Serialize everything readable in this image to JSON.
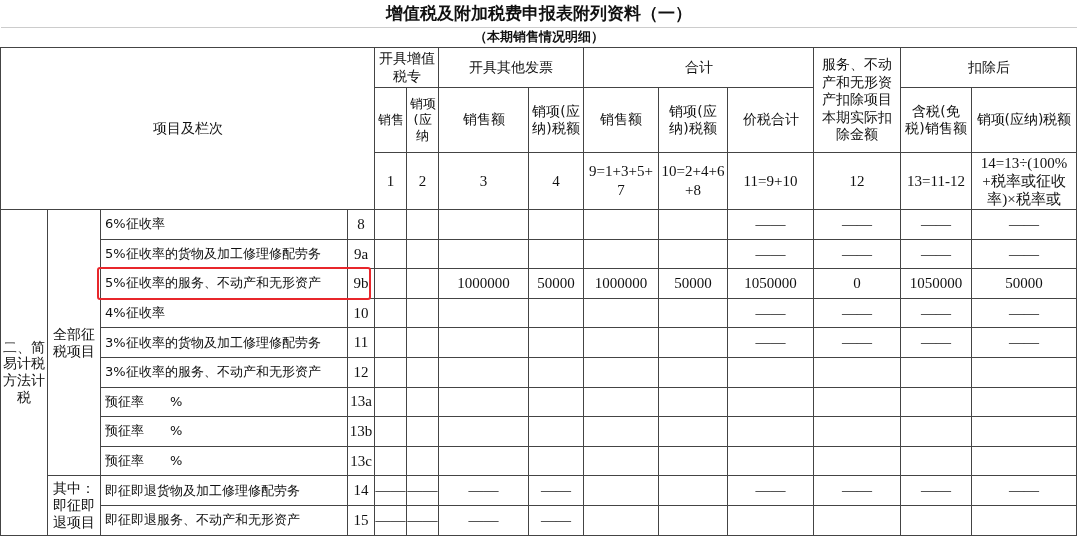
{
  "title": "增值税及附加税费申报表附列资料（一）",
  "subtitle": "（本期销售情况明细）",
  "item_header": "项目及栏次",
  "column_groups": [
    {
      "kind": "group",
      "label": "开具增值税专",
      "columns": [
        {
          "label": "销售",
          "number": "1"
        },
        {
          "label": "销项(应纳",
          "number": "2"
        }
      ]
    },
    {
      "kind": "group",
      "label": "开具其他发票",
      "columns": [
        {
          "label": "销售额",
          "number": "3"
        },
        {
          "label": "销项(应纳)税额",
          "number": "4"
        }
      ]
    },
    {
      "kind": "group",
      "label": "合计",
      "columns": [
        {
          "label": "销售额",
          "number": "9=1+3+5+7"
        },
        {
          "label": "销项(应纳)税额",
          "number": "10=2+4+6+8"
        },
        {
          "label": "价税合计",
          "number": "11=9+10"
        }
      ]
    },
    {
      "kind": "single",
      "label": "服务、不动产和无形资产扣除项目本期实际扣除金额",
      "number": "12"
    },
    {
      "kind": "group",
      "label": "扣除后",
      "columns": [
        {
          "label": "含税(免税)销售额",
          "number": "13=11-12"
        },
        {
          "label": "销项(应纳)税额",
          "number": "14=13÷(100%+税率或征收率)×税率或"
        }
      ]
    }
  ],
  "sections": [
    {
      "label": "二、简易计税方法计税",
      "subsections": [
        {
          "label": "全部征税项目",
          "rows": [
            {
              "item": "6%征收率",
              "line": "8",
              "highlighted": false,
              "cells": [
                {},
                {},
                {},
                {},
                {},
                {},
                {
                  "text": "——"
                },
                {
                  "text": "——"
                },
                {
                  "text": "——"
                },
                {
                  "text": "——"
                }
              ]
            },
            {
              "item": "5%征收率的货物及加工修理修配劳务",
              "line": "9a",
              "highlighted": false,
              "cells": [
                {},
                {},
                {},
                {},
                {},
                {},
                {
                  "text": "——"
                },
                {
                  "text": "——"
                },
                {
                  "text": "——"
                },
                {
                  "text": "——"
                }
              ]
            },
            {
              "item": "5%征收率的服务、不动产和无形资产",
              "line": "9b",
              "highlighted": true,
              "cells": [
                {},
                {},
                {
                  "text": "1000000"
                },
                {
                  "text": "50000"
                },
                {
                  "text": "1000000"
                },
                {
                  "text": "50000"
                },
                {
                  "text": "1050000"
                },
                {
                  "text": "0"
                },
                {
                  "text": "1050000"
                },
                {
                  "text": "50000"
                }
              ]
            },
            {
              "item": "4%征收率",
              "line": "10",
              "highlighted": false,
              "cells": [
                {},
                {},
                {},
                {},
                {},
                {},
                {
                  "text": "——"
                },
                {
                  "text": "——"
                },
                {
                  "text": "——"
                },
                {
                  "text": "——"
                }
              ]
            },
            {
              "item": "3%征收率的货物及加工修理修配劳务",
              "line": "11",
              "highlighted": false,
              "cells": [
                {},
                {},
                {},
                {},
                {},
                {},
                {
                  "text": "——"
                },
                {
                  "text": "——"
                },
                {
                  "text": "——"
                },
                {
                  "text": "——"
                }
              ]
            },
            {
              "item": "3%征收率的服务、不动产和无形资产",
              "line": "12",
              "highlighted": false,
              "cells": [
                {},
                {},
                {},
                {},
                {},
                {},
                {},
                {},
                {},
                {}
              ]
            },
            {
              "item": "预征率　　%",
              "line": "13a",
              "highlighted": false,
              "cells": [
                {},
                {},
                {},
                {},
                {},
                {},
                {},
                {},
                {},
                {}
              ]
            },
            {
              "item": "预征率　　%",
              "line": "13b",
              "highlighted": false,
              "cells": [
                {},
                {},
                {},
                {},
                {},
                {},
                {},
                {},
                {},
                {}
              ]
            },
            {
              "item": "预征率　　%",
              "line": "13c",
              "highlighted": false,
              "cells": [
                {},
                {},
                {},
                {},
                {},
                {},
                {},
                {},
                {},
                {}
              ]
            }
          ]
        },
        {
          "label": "其中：即征即退项目",
          "rows": [
            {
              "item": "即征即退货物及加工修理修配劳务",
              "line": "14",
              "highlighted": false,
              "cells": [
                {
                  "text": "——"
                },
                {
                  "text": "——"
                },
                {
                  "text": "——"
                },
                {
                  "text": "——"
                },
                {},
                {},
                {
                  "text": "——"
                },
                {
                  "text": "——"
                },
                {
                  "text": "——"
                },
                {
                  "text": "——"
                }
              ]
            },
            {
              "item": "即征即退服务、不动产和无形资产",
              "line": "15",
              "highlighted": false,
              "cells": [
                {
                  "text": "——"
                },
                {
                  "text": "——"
                },
                {
                  "text": "——"
                },
                {
                  "text": "——"
                },
                {},
                {},
                {},
                {},
                {},
                {}
              ]
            }
          ]
        }
      ]
    }
  ]
}
